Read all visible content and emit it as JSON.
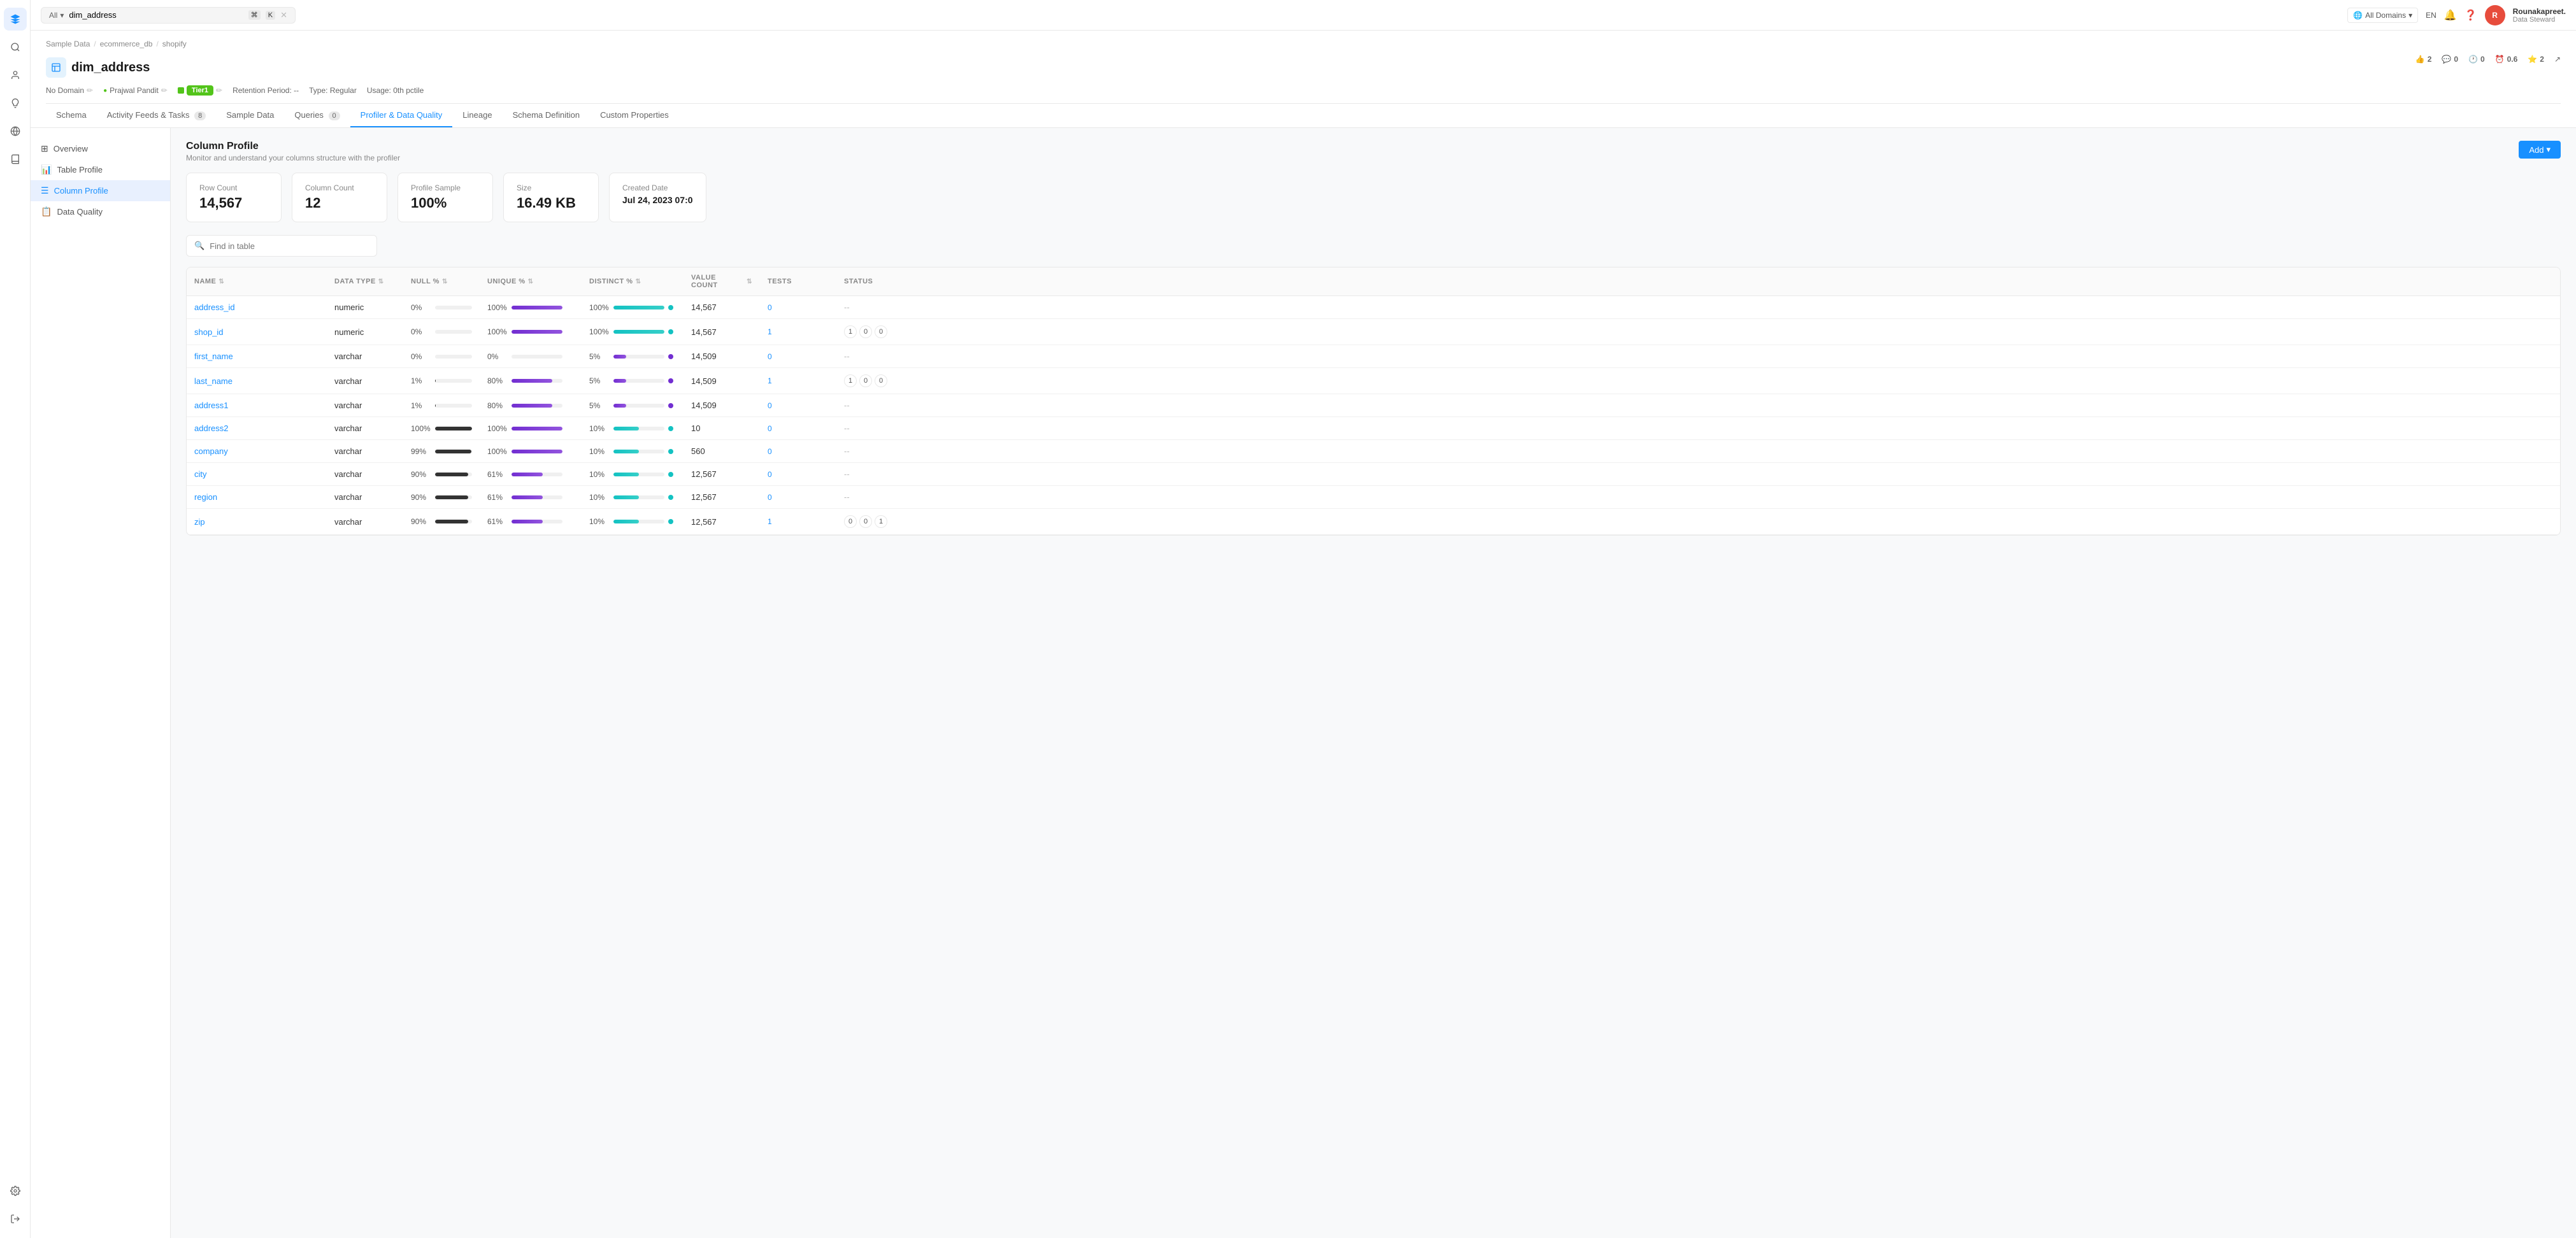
{
  "app": {
    "title": "OpenMetadata"
  },
  "topbar": {
    "search_placeholder": "dim_address",
    "search_type": "All",
    "kbd1": "⌘",
    "kbd2": "K",
    "domain_label": "All Domains",
    "lang": "EN",
    "user_name": "Rounakapreet.",
    "user_role": "Data Steward",
    "user_initials": "R"
  },
  "breadcrumb": {
    "items": [
      "Sample Data",
      "ecommerce_db",
      "shopify"
    ]
  },
  "entity": {
    "title": "dim_address",
    "domain": "No Domain",
    "owner": "Prajwal Pandit",
    "tier": "Tier1",
    "retention": "Retention Period: --",
    "type": "Type: Regular",
    "usage": "Usage: 0th pctile"
  },
  "top_actions": {
    "like": "2",
    "comment": "0",
    "time": "0",
    "schedule": "0.6",
    "star": "2"
  },
  "tabs": [
    {
      "label": "Schema",
      "badge": ""
    },
    {
      "label": "Activity Feeds & Tasks",
      "badge": "8"
    },
    {
      "label": "Sample Data",
      "badge": ""
    },
    {
      "label": "Queries",
      "badge": "0"
    },
    {
      "label": "Profiler & Data Quality",
      "badge": "",
      "active": true
    },
    {
      "label": "Lineage",
      "badge": ""
    },
    {
      "label": "Schema Definition",
      "badge": ""
    },
    {
      "label": "Custom Properties",
      "badge": ""
    }
  ],
  "sidebar": {
    "items": [
      {
        "label": "Overview",
        "icon": "⊞",
        "active": false
      },
      {
        "label": "Table Profile",
        "icon": "📊",
        "active": false
      },
      {
        "label": "Column Profile",
        "icon": "☰",
        "active": true
      },
      {
        "label": "Data Quality",
        "icon": "📋",
        "active": false
      }
    ]
  },
  "section": {
    "title": "Column Profile",
    "subtitle": "Monitor and understand your columns structure with the profiler",
    "add_label": "Add"
  },
  "stats": [
    {
      "label": "Row Count",
      "value": "14,567"
    },
    {
      "label": "Column Count",
      "value": "12"
    },
    {
      "label": "Profile Sample",
      "value": "100%"
    },
    {
      "label": "Size",
      "value": "16.49 KB"
    },
    {
      "label": "Created Date",
      "value": "Jul 24, 2023 07:0"
    }
  ],
  "search": {
    "placeholder": "Find in table"
  },
  "table": {
    "columns": [
      {
        "label": "NAME"
      },
      {
        "label": "DATA TYPE"
      },
      {
        "label": "NULL %"
      },
      {
        "label": "UNIQUE %"
      },
      {
        "label": "DISTINCT %"
      },
      {
        "label": "VALUE COUNT"
      },
      {
        "label": "TESTS"
      },
      {
        "label": "STATUS"
      }
    ],
    "rows": [
      {
        "name": "address_id",
        "data_type": "numeric",
        "null_pct": "0%",
        "null_bar": 0,
        "unique_pct": "100%",
        "unique_bar": 100,
        "distinct_pct": "100%",
        "distinct_bar": 100,
        "distinct_color": "teal",
        "value_count": "14,567",
        "tests": "0",
        "status": "--"
      },
      {
        "name": "shop_id",
        "data_type": "numeric",
        "null_pct": "0%",
        "null_bar": 0,
        "unique_pct": "100%",
        "unique_bar": 100,
        "distinct_pct": "100%",
        "distinct_bar": 100,
        "distinct_color": "teal",
        "value_count": "14,567",
        "tests": "1",
        "status": "badges",
        "badge_vals": [
          "1",
          "0",
          "0"
        ]
      },
      {
        "name": "first_name",
        "data_type": "varchar",
        "null_pct": "0%",
        "null_bar": 0,
        "unique_pct": "0%",
        "unique_bar": 0,
        "distinct_pct": "5%",
        "distinct_bar": 5,
        "distinct_color": "purple",
        "value_count": "14,509",
        "tests": "0",
        "status": "--"
      },
      {
        "name": "last_name",
        "data_type": "varchar",
        "null_pct": "1%",
        "null_bar": 1,
        "unique_pct": "80%",
        "unique_bar": 80,
        "distinct_pct": "5%",
        "distinct_bar": 5,
        "distinct_color": "purple",
        "value_count": "14,509",
        "tests": "1",
        "status": "badges",
        "badge_vals": [
          "1",
          "0",
          "0"
        ]
      },
      {
        "name": "address1",
        "data_type": "varchar",
        "null_pct": "1%",
        "null_bar": 1,
        "unique_pct": "80%",
        "unique_bar": 80,
        "distinct_pct": "5%",
        "distinct_bar": 5,
        "distinct_color": "purple",
        "value_count": "14,509",
        "tests": "0",
        "status": "--"
      },
      {
        "name": "address2",
        "data_type": "varchar",
        "null_pct": "100%",
        "null_bar": 100,
        "unique_pct": "100%",
        "unique_bar": 100,
        "distinct_pct": "10%",
        "distinct_bar": 10,
        "distinct_color": "teal",
        "value_count": "10",
        "tests": "0",
        "status": "--"
      },
      {
        "name": "company",
        "data_type": "varchar",
        "null_pct": "99%",
        "null_bar": 99,
        "unique_pct": "100%",
        "unique_bar": 100,
        "distinct_pct": "10%",
        "distinct_bar": 10,
        "distinct_color": "teal",
        "value_count": "560",
        "tests": "0",
        "status": "--"
      },
      {
        "name": "city",
        "data_type": "varchar",
        "null_pct": "90%",
        "null_bar": 90,
        "unique_pct": "61%",
        "unique_bar": 61,
        "distinct_pct": "10%",
        "distinct_bar": 10,
        "distinct_color": "teal",
        "value_count": "12,567",
        "tests": "0",
        "status": "--"
      },
      {
        "name": "region",
        "data_type": "varchar",
        "null_pct": "90%",
        "null_bar": 90,
        "unique_pct": "61%",
        "unique_bar": 61,
        "distinct_pct": "10%",
        "distinct_bar": 10,
        "distinct_color": "teal",
        "value_count": "12,567",
        "tests": "0",
        "status": "--"
      },
      {
        "name": "zip",
        "data_type": "varchar",
        "null_pct": "90%",
        "null_bar": 90,
        "unique_pct": "61%",
        "unique_bar": 61,
        "distinct_pct": "10%",
        "distinct_bar": 10,
        "distinct_color": "teal",
        "value_count": "12,567",
        "tests": "1",
        "status": "badges",
        "badge_vals": [
          "0",
          "0",
          "1"
        ]
      }
    ]
  }
}
